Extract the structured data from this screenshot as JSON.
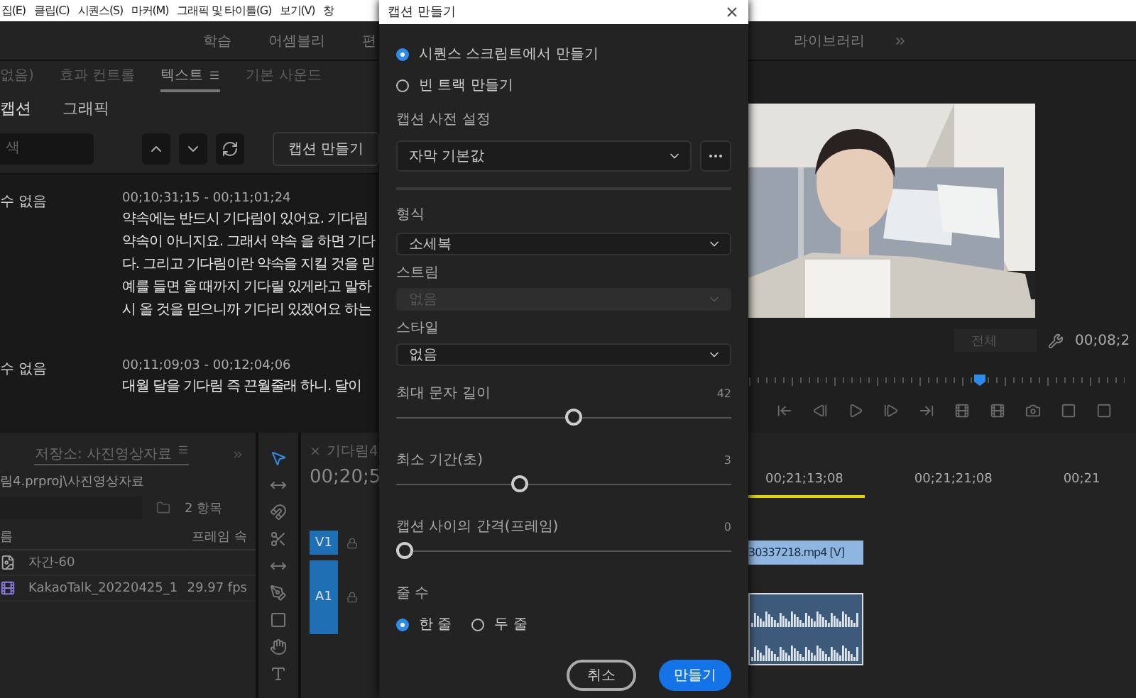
{
  "menu_bar": {
    "items": [
      "집(E)",
      "클립(C)",
      "시퀀스(S)",
      "마커(M)",
      "그래픽 및 타이틀(G)",
      "보기(V)",
      "창"
    ]
  },
  "workspace_tabs": [
    {
      "label": "학습",
      "selected": false
    },
    {
      "label": "어셈블리",
      "selected": false
    },
    {
      "label": "편",
      "selected": false
    },
    {
      "label": "라이브러리",
      "selected": false
    }
  ],
  "text_panel": {
    "tabs": [
      {
        "label": "없음)",
        "selected": false
      },
      {
        "label": "효과 컨트롤",
        "selected": false
      },
      {
        "label": "텍스트",
        "selected": true
      },
      {
        "label": "기본 사운드",
        "selected": false
      }
    ],
    "sub_tabs": [
      {
        "label": "캡션",
        "selected": true
      },
      {
        "label": "그래픽",
        "selected": false
      }
    ],
    "search": {
      "placeholder": "색"
    },
    "create_button": "캡션 만들기",
    "entries": [
      {
        "speaker": "수 없음",
        "time": "00;10;31;15 - 00;11;01;24",
        "lines": [
          "약속에는 반드시 기다림이 있어요. 기다림",
          "약속이 아니지요. 그래서 약속 을 하면 기다",
          "다. 그리고 기다림이란 약속을 지킬 것을 믿",
          "예를 들면 올 때까지 기다릴 있게라고 말하",
          "시 올 것을 믿으니까 기다리 있겠어요 하는"
        ]
      },
      {
        "speaker": "수 없음",
        "time": "00;11;09;03 - 00;12;04;06",
        "lines": [
          "대월 달을 기다림 즉 끈월줄래 하니. 달이"
        ]
      }
    ]
  },
  "project_panel": {
    "tab": "저장소: 사진영상자료",
    "path": "림4.prproj\\사진영상자료",
    "count": "2 항목",
    "columns": [
      "름",
      "프레임 속"
    ],
    "items": [
      {
        "kind": "graphic",
        "name": "자간-60"
      },
      {
        "kind": "video",
        "name": "KakaoTalk_20220425_1",
        "rate": "29.97 fps"
      }
    ]
  },
  "timeline": {
    "tab": "기다림4",
    "timecode": "00;20;5",
    "tracks": [
      {
        "name": "V1",
        "kind": "video"
      },
      {
        "name": "A1",
        "kind": "audio"
      }
    ],
    "ruler": [
      "00;21;13;08",
      "00;21;21;08",
      "00;21"
    ],
    "video_clip": "30337218.mp4 [V]"
  },
  "program_monitor": {
    "zoom": "전체",
    "timecode": "00;08;2"
  },
  "dialog": {
    "title": "캡션 만들기",
    "sources": [
      {
        "label": "시퀀스 스크립트에서 만들기",
        "selected": true
      },
      {
        "label": "빈 트랙 만들기",
        "selected": false
      }
    ],
    "preset": {
      "label": "캡션 사전 설정",
      "value": "자막 기본값"
    },
    "fields": [
      {
        "label": "형식",
        "value": "소세복",
        "disabled": false
      },
      {
        "label": "스트림",
        "value": "없음",
        "disabled": true
      },
      {
        "label": "스타일",
        "value": "없음",
        "disabled": false
      }
    ],
    "sliders": [
      {
        "label": "최대 문자 길이",
        "reading": "42",
        "level": 0.53
      },
      {
        "label": "최소 기간(초)",
        "reading": "3",
        "level": 0.37
      },
      {
        "label": "캡션 사이의 간격(프레임)",
        "reading": "0",
        "level": 0
      }
    ],
    "line_count": {
      "label": "줄 수",
      "options": [
        {
          "label": "한 줄",
          "selected": true
        },
        {
          "label": "두 줄",
          "selected": false
        }
      ]
    },
    "buttons": [
      {
        "label": "취소",
        "kind": "secondary"
      },
      {
        "label": "만들기",
        "kind": "primary"
      }
    ]
  }
}
